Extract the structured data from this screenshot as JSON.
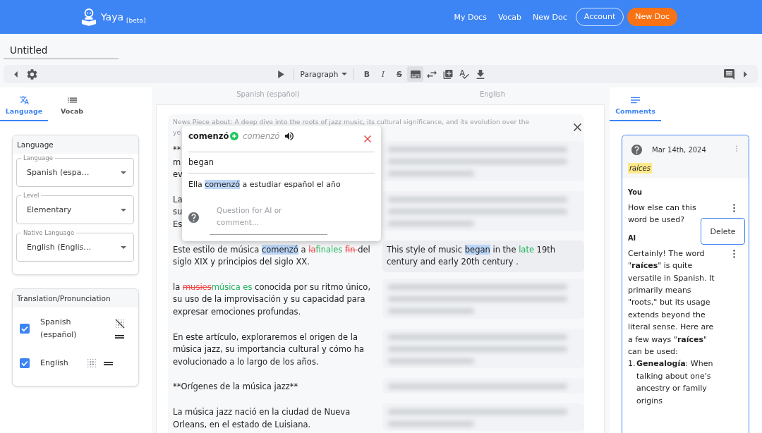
{
  "header": {
    "brand": "Yaya",
    "badge": "[beta]",
    "nav": [
      {
        "label": "My Docs",
        "kind": "link"
      },
      {
        "label": "Vocab",
        "kind": "link"
      },
      {
        "label": "New Doc",
        "kind": "link"
      },
      {
        "label": "Account",
        "kind": "outline"
      },
      {
        "label": "New Doc",
        "kind": "primary"
      }
    ]
  },
  "document": {
    "title": "Untitled"
  },
  "toolbar": {
    "style_menu": "Paragraph",
    "format_buttons": [
      {
        "label": "B",
        "kind": "bold"
      },
      {
        "label": "I",
        "kind": "italic"
      },
      {
        "label": "S",
        "kind": "strike"
      }
    ],
    "view_tools": [
      {
        "kind": "subtitles",
        "selected": true
      },
      {
        "kind": "swap",
        "selected": false
      },
      {
        "kind": "add",
        "selected": false
      },
      {
        "kind": "spellcheck",
        "selected": false
      },
      {
        "kind": "download",
        "selected": false
      }
    ]
  },
  "left_panel": {
    "tabs": [
      {
        "label": "Language",
        "selected": true
      },
      {
        "label": "Vocab",
        "selected": false
      }
    ],
    "language_card": {
      "title": "Language",
      "fields": [
        {
          "label": "Language",
          "value": "Spanish (espa…"
        },
        {
          "label": "Level",
          "value": "Elementary"
        },
        {
          "label": "Native Language",
          "value": "English (Englis…"
        }
      ]
    },
    "display_card": {
      "title": "Translation/Pronunciation",
      "rows": [
        {
          "label": "Spanish (español)",
          "checked": true,
          "blurred": false
        },
        {
          "label": "English",
          "checked": true,
          "blurred": true
        }
      ]
    }
  },
  "editor": {
    "columns": [
      "Spanish (español)",
      "English"
    ],
    "note_lines": [
      "News Piece about: A deep dive into the roots of jazz music, its cultural significance, and its evolution over the",
      "ye"
    ],
    "rows": [
      {
        "kind": "covered",
        "translation_blurred": true,
        "source_lines": [
          "**",
          "m",
          "ev"
        ]
      },
      {
        "kind": "covered",
        "translation_blurred": true,
        "source_lines": [
          "La",
          "su",
          "Es"
        ]
      },
      {
        "kind": "text",
        "translation_blurred": false,
        "source": [
          {
            "text": "Este estilo de música ",
            "kind": "plain"
          },
          {
            "text": "comenzó",
            "kind": "highlight"
          },
          {
            "text": " a ",
            "kind": "plain"
          },
          {
            "text": "la",
            "kind": "deleted"
          },
          {
            "text": "finales ",
            "kind": "inserted"
          },
          {
            "text": "fin ",
            "kind": "deleted"
          },
          {
            "text": "del siglo XIX y principios del siglo XX.",
            "kind": "plain"
          }
        ],
        "translation": [
          {
            "text": "This style of music ",
            "kind": "plain"
          },
          {
            "text": "began",
            "kind": "highlight"
          },
          {
            "text": " in the ",
            "kind": "plain"
          },
          {
            "text": "late",
            "kind": "inserted"
          },
          {
            "text": " 19th century and early 20th century .",
            "kind": "plain"
          }
        ]
      },
      {
        "kind": "text",
        "translation_blurred": true,
        "source": [
          {
            "text": "la ",
            "kind": "plain"
          },
          {
            "text": "musies",
            "kind": "deleted"
          },
          {
            "text": "música es",
            "kind": "inserted"
          },
          {
            "text": " conocida por su ritmo único, su uso de la improvisación y su capacidad para expresar emociones profundas.",
            "kind": "plain"
          }
        ]
      },
      {
        "kind": "text",
        "translation_blurred": true,
        "source": [
          {
            "text": "En este artículo, exploraremos el origen de la música jazz, su importancia cultural y cómo ha evolucionado a lo largo de los años.",
            "kind": "plain"
          }
        ]
      },
      {
        "kind": "text",
        "translation_blurred": true,
        "source": [
          {
            "text": "**Orígenes de la música jazz**",
            "kind": "plain"
          }
        ]
      },
      {
        "kind": "text",
        "translation_blurred": true,
        "source": [
          {
            "text": "La música jazz nació en la ciudad de Nueva Orleans, en el estado de Luisiana.",
            "kind": "plain"
          }
        ]
      }
    ]
  },
  "word_popup": {
    "word": "comenzó",
    "lemma": "comenzó",
    "translation": "began",
    "example": [
      {
        "text": "Ella ",
        "kind": "plain"
      },
      {
        "text": "comenzó",
        "kind": "highlight"
      },
      {
        "text": " a estudiar español el año",
        "kind": "plain"
      }
    ],
    "question_placeholder": "Question for AI or comment..."
  },
  "right_panel": {
    "tabs": [
      {
        "label": "Comments",
        "selected": true
      }
    ],
    "comment": {
      "date": "Mar 14th, 2024",
      "quote": "raíces",
      "messages": [
        {
          "author": "You",
          "text": "How else can this word be used?",
          "menu": [
            "Delete"
          ]
        },
        {
          "author": "AI",
          "text": "Certainly! The word \"**raíces**\" is quite versatile in Spanish. It primarily means \"roots,\" but its usage extends beyond the literal sense. Here are a few ways \"**raíces**\" can be used:",
          "list": [
            {
              "number": "1.",
              "text": "**Genealogía**: When talking about one's ancestry or family origins"
            }
          ]
        }
      ]
    }
  }
}
